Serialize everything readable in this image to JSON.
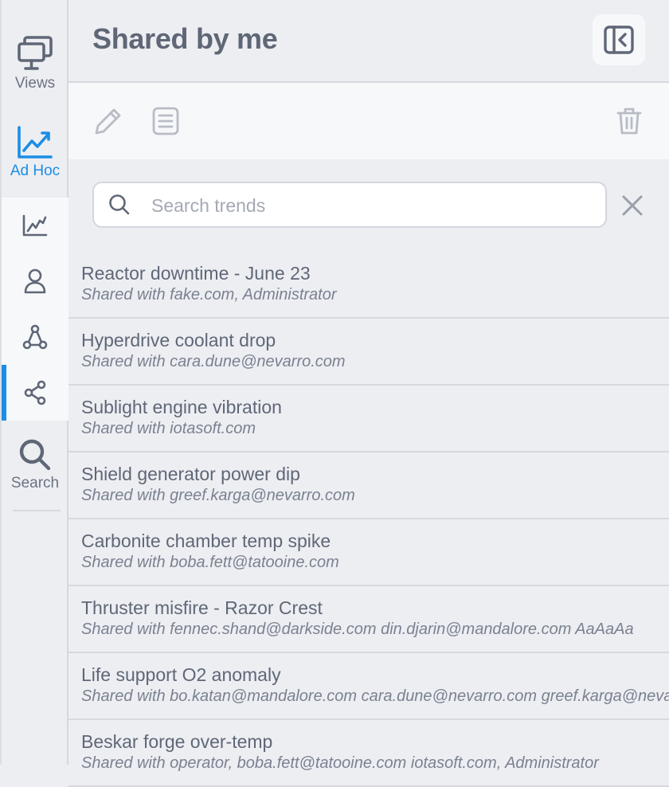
{
  "nav": {
    "views_label": "Views",
    "adhoc_label": "Ad Hoc",
    "search_label": "Search",
    "accent_color": "#1a8ee6",
    "sub_items": [
      "chart-line-icon",
      "person-icon",
      "network-icon",
      "share-icon"
    ]
  },
  "header": {
    "title": "Shared by me"
  },
  "search": {
    "placeholder": "Search trends",
    "value": ""
  },
  "items": [
    {
      "name": "Reactor downtime - June 23",
      "shared": "Shared with fake.com, Administrator"
    },
    {
      "name": "Hyperdrive coolant drop",
      "shared": "Shared with cara.dune@nevarro.com"
    },
    {
      "name": "Sublight engine vibration",
      "shared": "Shared with iotasoft.com"
    },
    {
      "name": "Shield generator power dip",
      "shared": "Shared with greef.karga@nevarro.com"
    },
    {
      "name": "Carbonite chamber temp spike",
      "shared": "Shared with boba.fett@tatooine.com"
    },
    {
      "name": "Thruster misfire - Razor Crest",
      "shared": "Shared with fennec.shand@darkside.com din.djarin@mandalore.com AaAaAa"
    },
    {
      "name": "Life support O2 anomaly",
      "shared": "Shared with bo.katan@mandalore.com cara.dune@nevarro.com greef.karga@nevarro.com"
    },
    {
      "name": "Beskar forge over-temp",
      "shared": "Shared with operator, boba.fett@tatooine.com iotasoft.com, Administrator"
    }
  ]
}
